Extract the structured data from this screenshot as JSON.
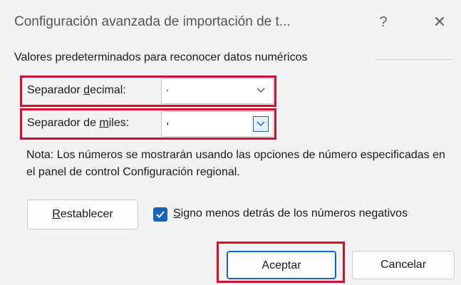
{
  "window": {
    "title": "Configuración avanzada de importación de t...",
    "help_glyph": "?",
    "close_glyph": "✕"
  },
  "group": {
    "label": "Valores predeterminados para reconocer datos numéricos"
  },
  "decimal_separator": {
    "label_pre": "Separador ",
    "label_accel": "d",
    "label_post": "ecimal:",
    "value": "."
  },
  "thousands_separator": {
    "label_pre": "Separador de ",
    "label_accel": "m",
    "label_post": "iles:",
    "value": ","
  },
  "note": {
    "text": "Nota: Los números se mostrarán usando las opciones de número especificadas en el panel de control Configuración regional."
  },
  "reset_button": {
    "label_accel": "R",
    "label_post": "establecer"
  },
  "negative_sign_checkbox": {
    "checked": true,
    "label_accel": "S",
    "label_post": "igno menos detrás de los números negativos"
  },
  "ok_button": {
    "label": "Aceptar"
  },
  "cancel_button": {
    "label": "Cancelar"
  },
  "colors": {
    "highlight": "#d10f2f",
    "accent": "#1565c0",
    "background": "#f3f3f3"
  }
}
